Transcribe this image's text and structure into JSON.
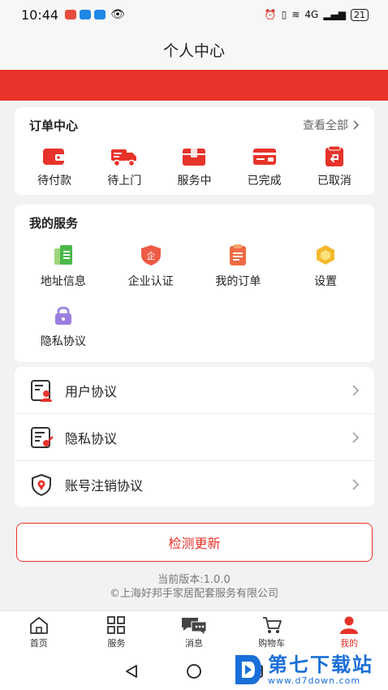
{
  "status": {
    "time": "10:44",
    "battery": "21",
    "network": "4G"
  },
  "header": {
    "title": "个人中心"
  },
  "orders": {
    "title": "订单中心",
    "view_all": "查看全部",
    "items": [
      {
        "label": "待付款",
        "icon": "wallet-icon"
      },
      {
        "label": "待上门",
        "icon": "truck-icon"
      },
      {
        "label": "服务中",
        "icon": "box-icon"
      },
      {
        "label": "已完成",
        "icon": "card-done-icon"
      },
      {
        "label": "已取消",
        "icon": "cancel-icon"
      }
    ]
  },
  "services": {
    "title": "我的服务",
    "items": [
      {
        "label": "地址信息",
        "icon": "address-icon"
      },
      {
        "label": "企业认证",
        "icon": "enterprise-shield-icon"
      },
      {
        "label": "我的订单",
        "icon": "order-list-icon"
      },
      {
        "label": "设置",
        "icon": "hexagon-settings-icon"
      },
      {
        "label": "隐私协议",
        "icon": "lock-icon"
      }
    ]
  },
  "agreements": [
    {
      "label": "用户协议",
      "icon": "user-doc-icon"
    },
    {
      "label": "隐私协议",
      "icon": "privacy-doc-icon"
    },
    {
      "label": "账号注销协议",
      "icon": "location-shield-icon"
    }
  ],
  "update_button": "检测更新",
  "version": {
    "line1": "当前版本:1.0.0",
    "line2": "©上海好邦手家居配套服务有限公司"
  },
  "tabs": [
    {
      "label": "首页",
      "icon": "home-icon"
    },
    {
      "label": "服务",
      "icon": "grid-icon"
    },
    {
      "label": "消息",
      "icon": "chat-icon"
    },
    {
      "label": "购物车",
      "icon": "cart-icon"
    },
    {
      "label": "我的",
      "icon": "person-icon",
      "active": true
    }
  ],
  "watermark": {
    "title": "第七下载站",
    "url": "www.d7down.com"
  },
  "colors": {
    "accent": "#e7332a",
    "background": "#f2f2f2",
    "card": "#ffffff",
    "watermark": "#1a6fd8"
  }
}
